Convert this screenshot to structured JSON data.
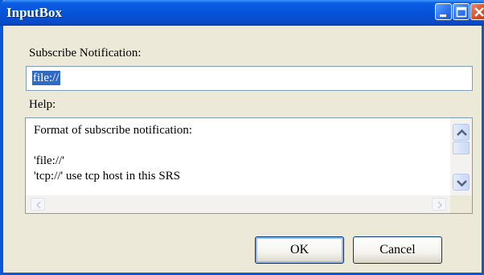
{
  "window": {
    "title": "InputBox",
    "controls": [
      "minimize-icon",
      "maximize-icon",
      "close-icon"
    ]
  },
  "form": {
    "subscribe_label": "Subscribe Notification:",
    "subscribe_value": "file://",
    "help_label": "Help:",
    "help_text": "Format of subscribe notification:\n\n'file://'\n'tcp://' use tcp host in this SRS"
  },
  "buttons": {
    "ok_label": "OK",
    "cancel_label": "Cancel"
  },
  "colors": {
    "titlebar": "#0653d8",
    "selection": "#316ac5",
    "dialog_bg": "#ece9d8"
  }
}
